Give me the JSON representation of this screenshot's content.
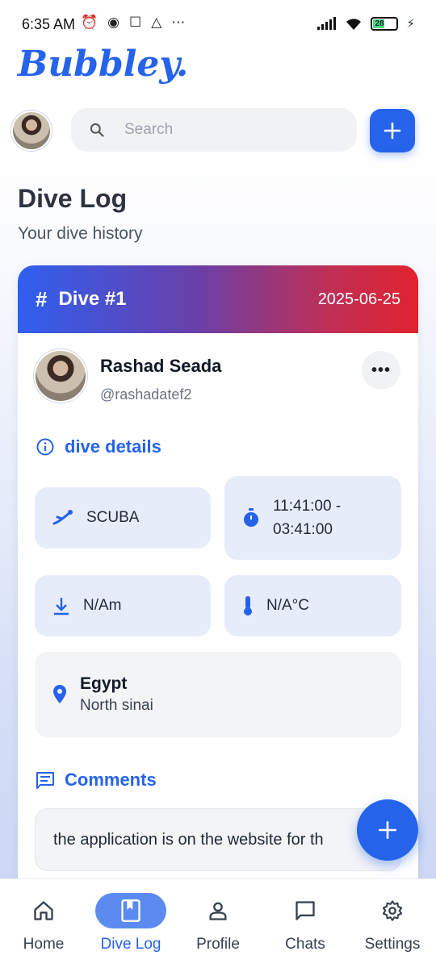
{
  "status_bar": {
    "time": "6:35 AM",
    "battery": "28"
  },
  "brand": "Bubbley.",
  "search": {
    "placeholder": "Search"
  },
  "page": {
    "title": "Dive Log",
    "subtitle": "Your dive history"
  },
  "dive": {
    "title": "Dive #1",
    "date": "2025-06-25",
    "user": {
      "name": "Rashad Seada",
      "handle": "@rashadatef2"
    },
    "details_label": "dive details",
    "type": "SCUBA",
    "time_start": "11:41:00 -",
    "time_end": "03:41:00",
    "depth": "N/Am",
    "temperature": "N/A°C",
    "location": {
      "country": "Egypt",
      "region": "North sinai"
    },
    "comments_label": "Comments",
    "comment": "the application is on the website for th"
  },
  "nav": [
    {
      "label": "Home",
      "icon": "home-icon"
    },
    {
      "label": "Dive Log",
      "icon": "book-icon"
    },
    {
      "label": "Profile",
      "icon": "person-icon"
    },
    {
      "label": "Chats",
      "icon": "chat-icon"
    },
    {
      "label": "Settings",
      "icon": "gear-icon"
    }
  ],
  "colors": {
    "accent": "#2563eb",
    "header_start": "#2f5ff0",
    "header_end": "#e1232e",
    "tile": "#e7ecfb"
  }
}
